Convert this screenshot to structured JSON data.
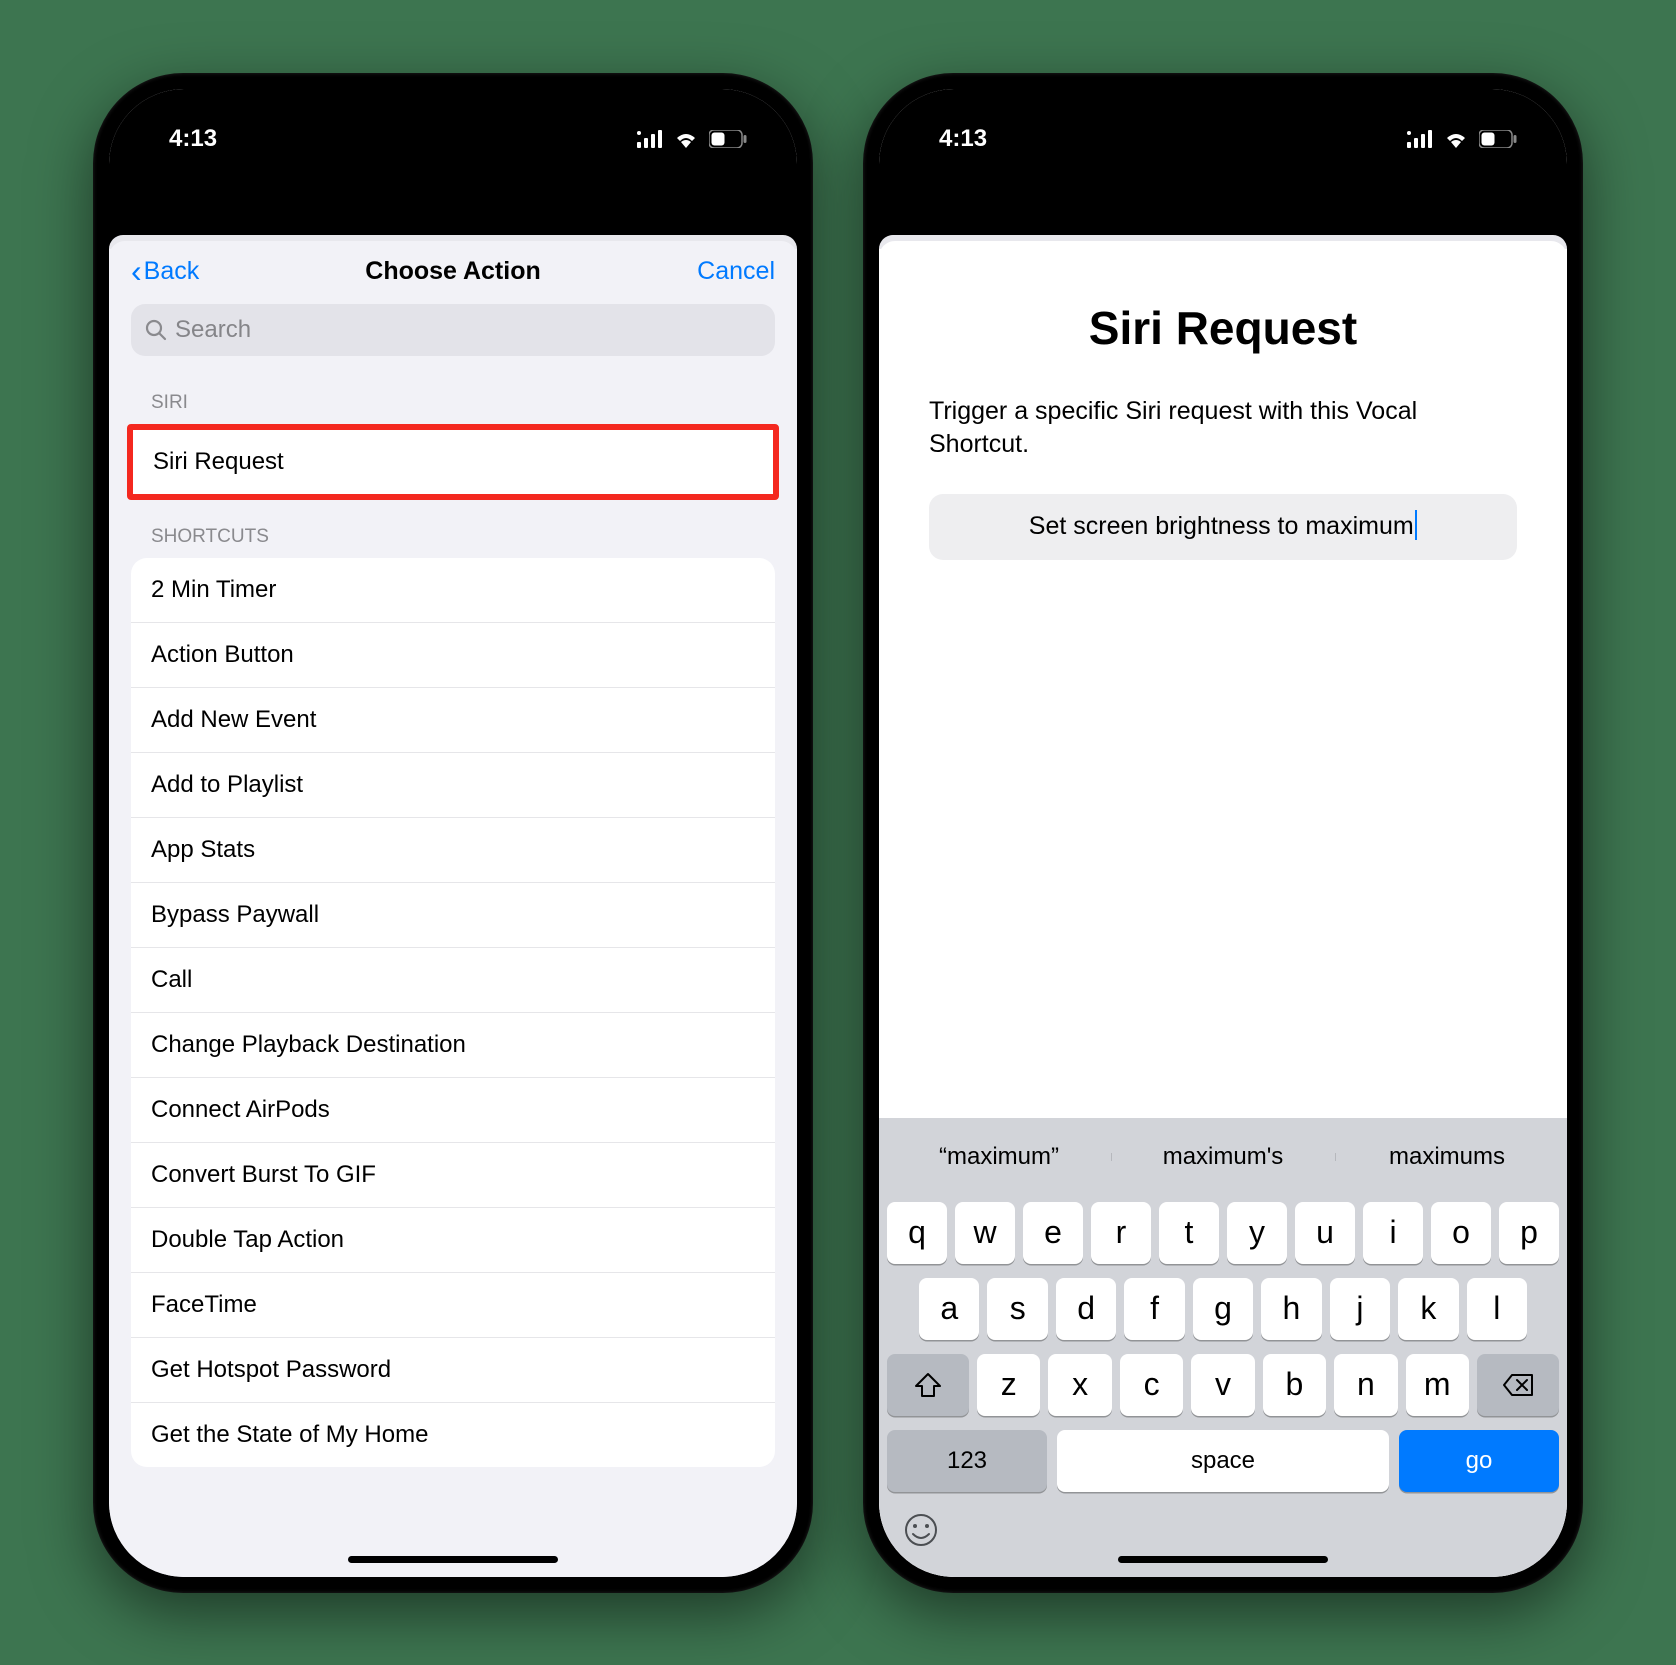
{
  "status": {
    "time": "4:13"
  },
  "screen1": {
    "nav": {
      "back": "Back",
      "title": "Choose Action",
      "cancel": "Cancel"
    },
    "search_placeholder": "Search",
    "siri_header": "SIRI",
    "siri_item": "Siri Request",
    "shortcuts_header": "SHORTCUTS",
    "shortcuts": [
      "2 Min Timer",
      "Action Button",
      "Add New Event",
      "Add to Playlist",
      "App Stats",
      "Bypass Paywall",
      "Call",
      "Change Playback Destination",
      "Connect AirPods",
      "Convert Burst To GIF",
      "Double Tap Action",
      "FaceTime",
      "Get Hotspot Password",
      "Get the State of My Home"
    ]
  },
  "screen2": {
    "title": "Siri Request",
    "subtitle": "Trigger a specific Siri request with this Vocal Shortcut.",
    "input_value": "Set screen brightness to maximum",
    "suggestions": [
      "“maximum”",
      "maximum's",
      "maximums"
    ],
    "keys_row1": [
      "q",
      "w",
      "e",
      "r",
      "t",
      "y",
      "u",
      "i",
      "o",
      "p"
    ],
    "keys_row2": [
      "a",
      "s",
      "d",
      "f",
      "g",
      "h",
      "j",
      "k",
      "l"
    ],
    "keys_row3": [
      "z",
      "x",
      "c",
      "v",
      "b",
      "n",
      "m"
    ],
    "key_123": "123",
    "key_space": "space",
    "key_go": "go"
  }
}
